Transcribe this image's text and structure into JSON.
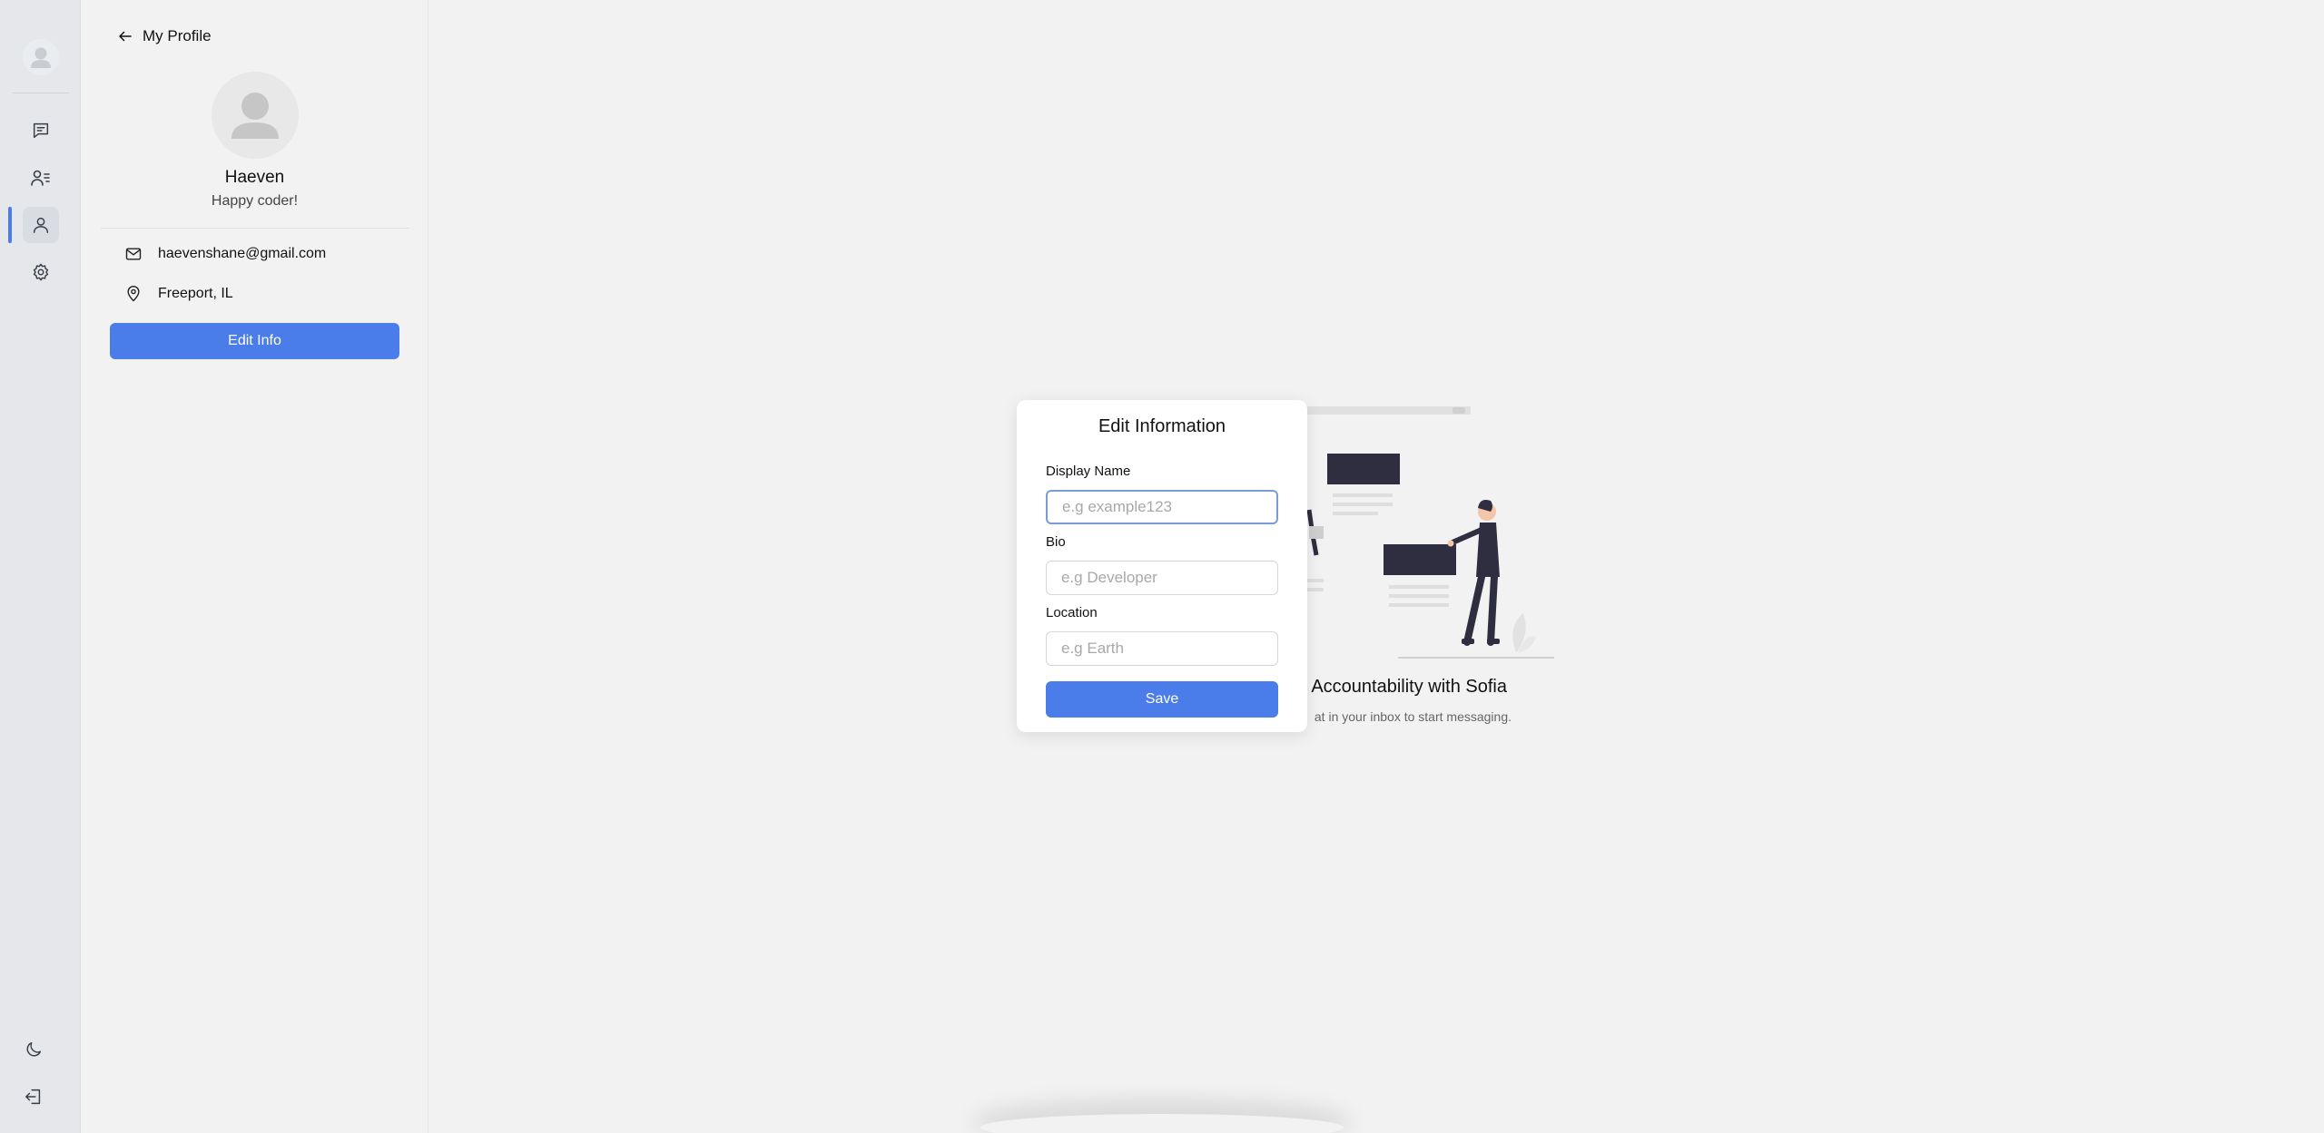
{
  "rail": {
    "items": [
      {
        "name": "chats",
        "icon": "message-square-icon"
      },
      {
        "name": "contacts",
        "icon": "user-list-icon"
      },
      {
        "name": "profile",
        "icon": "user-icon",
        "active": true
      },
      {
        "name": "settings",
        "icon": "gear-icon"
      }
    ],
    "bottom_items": [
      {
        "name": "theme",
        "icon": "moon-icon"
      },
      {
        "name": "logout",
        "icon": "logout-icon"
      }
    ]
  },
  "profile": {
    "header_title": "My Profile",
    "name": "Haeven",
    "bio": "Happy coder!",
    "email": "haevenshane@gmail.com",
    "location": "Freeport, IL",
    "edit_button_label": "Edit Info"
  },
  "welcome": {
    "title": "o Accountability with Sofia",
    "subtitle": "at in your inbox to start messaging."
  },
  "modal": {
    "title": "Edit Information",
    "fields": {
      "display_name": {
        "label": "Display Name",
        "placeholder": "e.g example123",
        "value": ""
      },
      "bio": {
        "label": "Bio",
        "placeholder": "e.g Developer",
        "value": ""
      },
      "location": {
        "label": "Location",
        "placeholder": "e.g Earth",
        "value": ""
      }
    },
    "save_label": "Save"
  },
  "colors": {
    "accent": "#4a7de9",
    "rail_background": "#e5e7eb",
    "page_background": "#f2f2f2",
    "focus_border": "#7a9cd6"
  }
}
